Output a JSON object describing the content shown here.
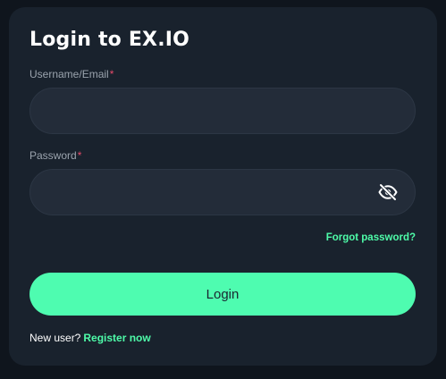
{
  "login_card": {
    "title": "Login to EX.IO",
    "username": {
      "label": "Username/Email",
      "required_mark": "*",
      "value": "",
      "placeholder": ""
    },
    "password": {
      "label": "Password",
      "required_mark": "*",
      "value": "",
      "placeholder": "",
      "toggle_icon": "eye-slash-icon"
    },
    "forgot_password_link": "Forgot password?",
    "login_button": "Login",
    "footer": {
      "new_user_text": "New user?",
      "register_link": "Register now"
    }
  },
  "colors": {
    "page_background": "#0f151d",
    "card_background": "#19222d",
    "input_background": "#232c39",
    "accent": "#4efcb0",
    "required_mark": "#e64a6a",
    "label_text": "#9aa3ad"
  }
}
